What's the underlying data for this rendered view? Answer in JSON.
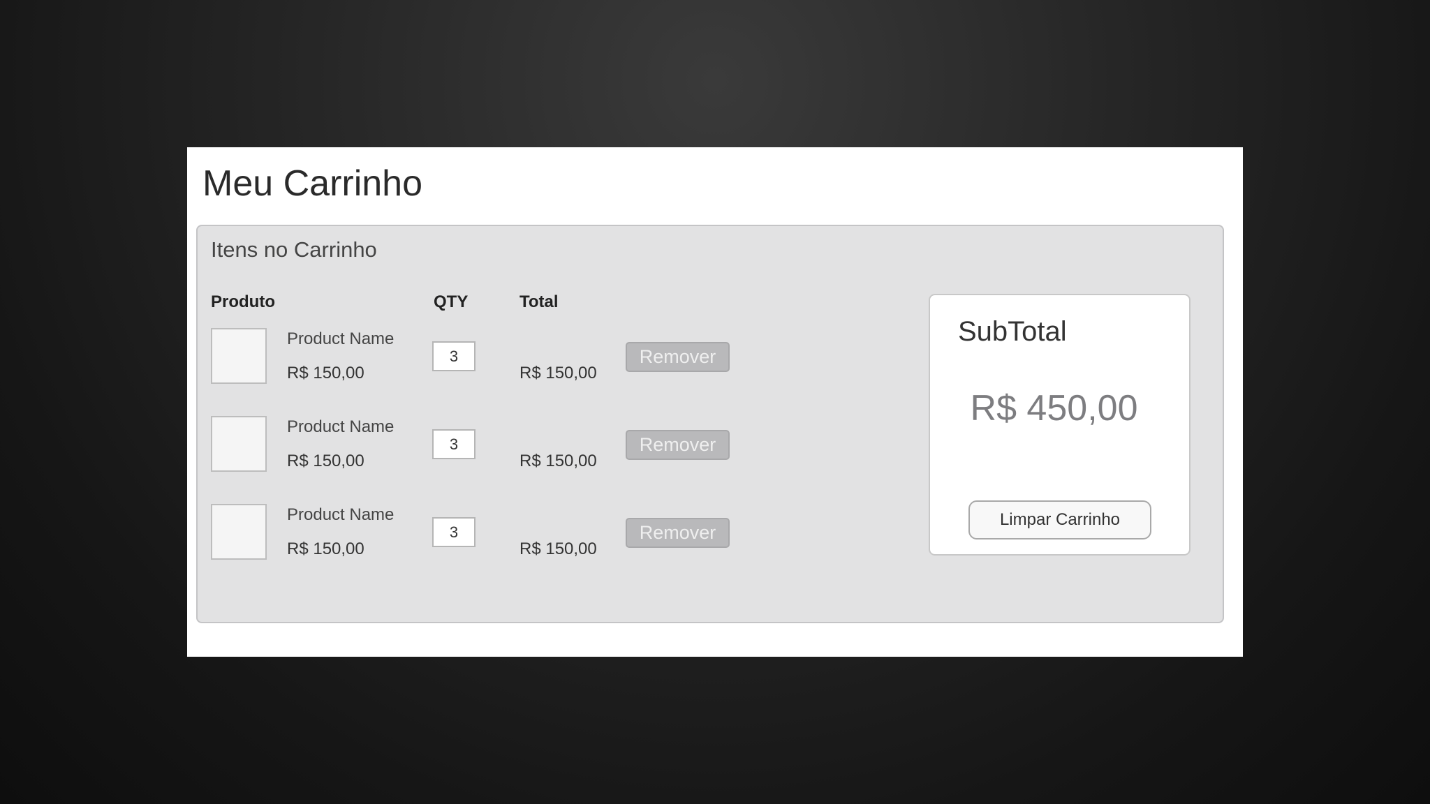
{
  "page": {
    "title": "Meu Carrinho"
  },
  "cart": {
    "heading": "Itens no Carrinho",
    "columns": {
      "product": "Produto",
      "qty": "QTY",
      "total": "Total"
    },
    "items": [
      {
        "name": "Product Name",
        "price": "R$ 150,00",
        "qty": "3",
        "total": "R$ 150,00",
        "remove_label": "Remover"
      },
      {
        "name": "Product Name",
        "price": "R$ 150,00",
        "qty": "3",
        "total": "R$ 150,00",
        "remove_label": "Remover"
      },
      {
        "name": "Product Name",
        "price": "R$ 150,00",
        "qty": "3",
        "total": "R$ 150,00",
        "remove_label": "Remover"
      }
    ]
  },
  "summary": {
    "title": "SubTotal",
    "value": "R$ 450,00",
    "clear_label": "Limpar Carrinho"
  },
  "colors": {
    "panel_bg": "#e2e2e3",
    "remove_button_bg": "#b9b9bb",
    "subtotal_text": "#7d7d80"
  }
}
